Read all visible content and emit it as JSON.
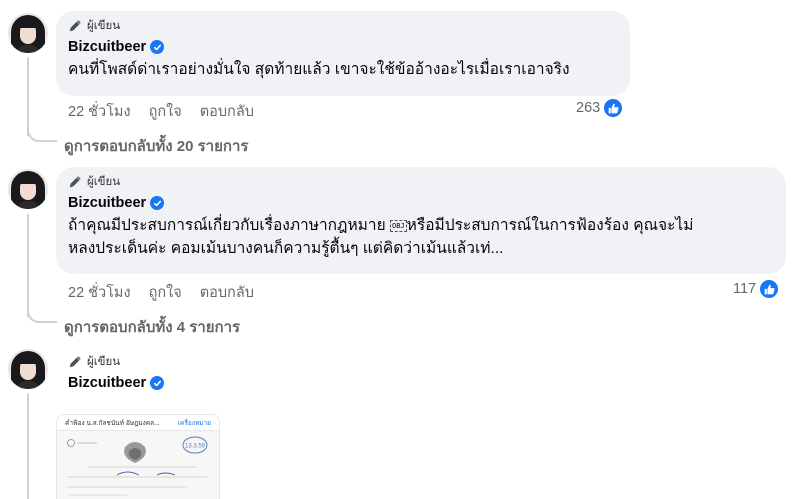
{
  "comments": [
    {
      "author_badge": "ผู้เขียน",
      "name": "Bizcuitbeer",
      "text": "คนที่โพสด์ด่าเราอย่างมั่นใจ สุดท้ายแล้ว เขาจะใช้ข้ออ้างอะไรเมื่อเราเอาจริง",
      "time": "22 ชั่วโมง",
      "like_label": "ถูกใจ",
      "reply_label": "ตอบกลับ",
      "reaction_count": "263",
      "view_replies": "ดูการตอบกลับทั้ง 20 รายการ"
    },
    {
      "author_badge": "ผู้เขียน",
      "name": "Bizcuitbeer",
      "text_line1": "ถ้าคุณมีประสบการณ์เกี่ยวกับเรื่องภาษากฎหมาย",
      "text_glyph": "OBJ",
      "text_line1_end": "หรือมีประสบการณ์ในการฟ้องร้อง คุณจะไม่",
      "text_line2": "หลงประเด็นค่ะ คอมเม้นบางคนก็ความรู้ตื้นๆ แต่คิดว่าเม้นแล้วเท่...",
      "time": "22 ชั่วโมง",
      "like_label": "ถูกใจ",
      "reply_label": "ตอบกลับ",
      "reaction_count": "117",
      "view_replies": "ดูการตอบกลับทั้ง 4 รายการ"
    },
    {
      "author_badge": "ผู้เขียน",
      "name": "Bizcuitbeer",
      "attachment": {
        "title": "คำฟ้อง น.ส.กัลชนันท์ อัษฎมงคล...",
        "link": "เครื่องหมาย",
        "stamp_text": "13.3.59"
      }
    }
  ],
  "colors": {
    "bubble_bg": "#f0f2f5",
    "meta_text": "#65676b",
    "accent_blue": "#1877f2",
    "thread_line": "#ced0d4"
  },
  "icons": [
    "pen-icon",
    "verified-badge-icon",
    "like-reaction-icon"
  ]
}
